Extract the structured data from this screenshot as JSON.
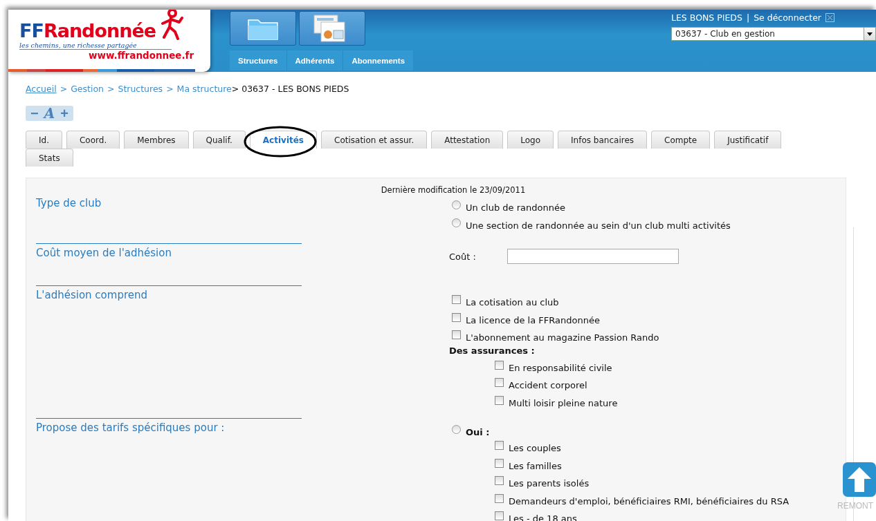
{
  "logo": {
    "prefix": "FF",
    "wordmark": "Randonnée",
    "tagline": "les chemins, une richesse partagée",
    "url": "www.ffrandonnee.fr"
  },
  "nav": [
    "Structures",
    "Adhérents",
    "Abonnements"
  ],
  "user": {
    "name": "LES BONS PIEDS",
    "separator": "|",
    "logout": "Se déconnecter",
    "structure_select": "03637 - Club en gestion"
  },
  "breadcrumb": [
    {
      "kind": "home",
      "text": "Accueil"
    },
    {
      "kind": "sep",
      "text": ">"
    },
    {
      "kind": "link",
      "text": "Gestion"
    },
    {
      "kind": "sep",
      "text": ">"
    },
    {
      "kind": "link",
      "text": "Structures"
    },
    {
      "kind": "sep",
      "text": ">"
    },
    {
      "kind": "link",
      "text": "Ma structure"
    },
    {
      "kind": "current",
      "text": "> 03637 - LES BONS PIEDS"
    }
  ],
  "font_controls": [
    "−",
    "A",
    "+"
  ],
  "tabs": [
    {
      "label": "Id.",
      "selected": false
    },
    {
      "label": "Coord.",
      "selected": false
    },
    {
      "label": "Membres",
      "selected": false
    },
    {
      "label": "Qualif.",
      "selected": false
    },
    {
      "label": "Activités",
      "selected": true
    },
    {
      "label": "Cotisation et assur.",
      "selected": false
    },
    {
      "label": "Attestation",
      "selected": false
    },
    {
      "label": "Logo",
      "selected": false
    },
    {
      "label": "Infos bancaires",
      "selected": false
    },
    {
      "label": "Compte",
      "selected": false
    },
    {
      "label": "Justificatif",
      "selected": false
    },
    {
      "label": "Stats",
      "selected": false
    }
  ],
  "form": {
    "last_modified": "Dernière modification le 23/09/2011",
    "sections": [
      {
        "label": "Type de club",
        "kind": "radios",
        "options": [
          {
            "label": "Un club de randonnée",
            "selected": false
          },
          {
            "label": "Une section de randonnée au sein d'un club multi activités",
            "selected": false
          }
        ]
      },
      {
        "label": "Coût moyen de l'adhésion",
        "kind": "field",
        "field_label": "Coût :"
      },
      {
        "label": "L'adhésion comprend",
        "kind": "checks",
        "options": [
          {
            "label": "La cotisation au club",
            "checked": false
          },
          {
            "label": "La licence de la FFRandonnée",
            "checked": false
          },
          {
            "label": "L'abonnement au magazine Passion Rando",
            "checked": false
          }
        ],
        "subheading": "Des assurances :",
        "suboptions": [
          {
            "label": "En responsabilité civile",
            "checked": false
          },
          {
            "label": "Accident corporel",
            "checked": false
          },
          {
            "label": "Multi loisir pleine nature",
            "checked": false
          }
        ]
      },
      {
        "label": "Propose des tarifs spécifiques pour :",
        "kind": "radio-checks",
        "radio": {
          "label": "Oui :",
          "selected": false
        },
        "suboptions": [
          {
            "label": "Les couples",
            "checked": false
          },
          {
            "label": "Les familles",
            "checked": false
          },
          {
            "label": "Les parents isolés",
            "checked": false
          },
          {
            "label": "Demandeurs d'emploi, bénéficiaires RMI, bénéficiaires du RSA",
            "checked": false
          },
          {
            "label": "Les - de 18 ans",
            "checked": false
          }
        ]
      }
    ]
  },
  "scroll_top": {
    "label": "REMONT"
  }
}
